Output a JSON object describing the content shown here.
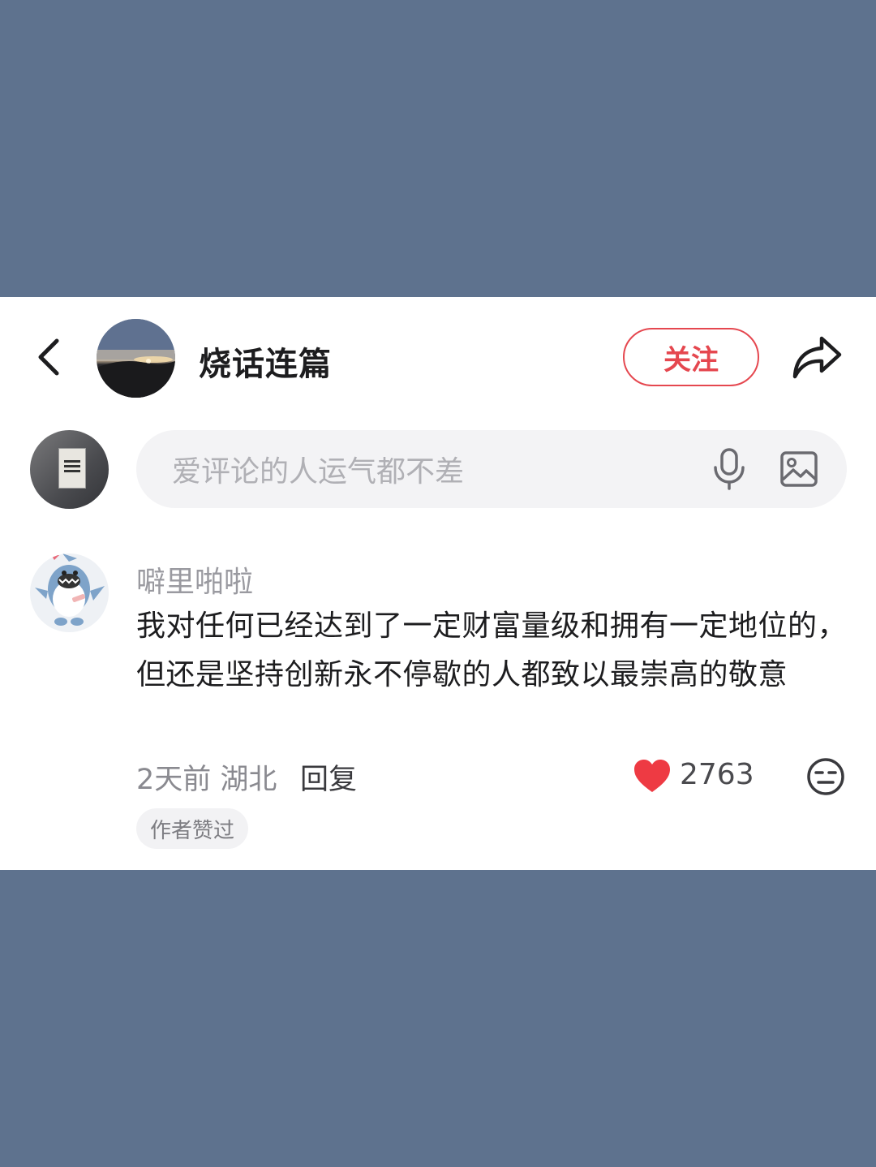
{
  "header": {
    "author_name": "烧话连篇",
    "follow_label": "关注",
    "icons": {
      "back": "back-arrow-icon",
      "share": "share-icon"
    }
  },
  "composer": {
    "placeholder": "爱评论的人运气都不差",
    "icons": {
      "mic": "mic-icon",
      "image": "image-icon"
    }
  },
  "comment": {
    "username": "噼里啪啦",
    "text": "我对任何已经达到了一定财富量级和拥有一定地位的，但还是坚持创新永不停歇的人都致以最崇高的敬意",
    "meta": "2天前 湖北",
    "reply_label": "回复",
    "like_count": "2763",
    "author_liked_tag": "作者赞过",
    "icons": {
      "like": "heart-icon",
      "emoji": "emoji-icon"
    }
  },
  "colors": {
    "background": "#5e728e",
    "accent": "#e5474f",
    "card": "#ffffff",
    "input_bg": "#f3f3f5"
  }
}
